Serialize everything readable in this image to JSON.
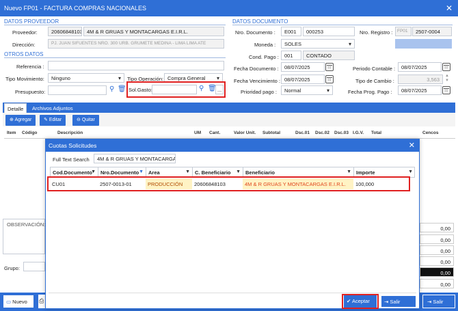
{
  "window": {
    "title": "Nuevo FP01 - FACTURA COMPRAS NACIONALES",
    "close": "✕"
  },
  "proveedor": {
    "section": "DATOS PROVEEDOR",
    "proveedor_label": "Proveedor:",
    "ruc": "20606848103",
    "name": "4M & R GRUAS Y MONTACARGAS E.I.R.L.",
    "direccion_label": "Dirección:",
    "direccion": "PJ. JUAN SIFUENTES NRO. 300 URB. GRUMETE MEDINA - LIMA LIMA ATE"
  },
  "documento": {
    "section": "DATOS DOCUMENTO",
    "nro_label": "Nro. Documento :",
    "serie": "E001",
    "numero": "000253",
    "registro_label": "Nro. Registro :",
    "reg_prefix": "FP01",
    "reg_number": "2507-0004",
    "moneda_label": "Moneda :",
    "moneda": "SOLES",
    "cond_label": "Cond. Pago :",
    "cond_code": "001",
    "cond_name": "CONTADO",
    "fecha_doc_label": "Fecha Documento :",
    "fecha_doc": "08/07/2025",
    "periodo_label": "Periodo Contable :",
    "periodo": "08/07/2025",
    "fecha_venc_label": "Fecha Vencimiento :",
    "fecha_venc": "08/07/2025",
    "tipo_cambio_label": "Tipo de Cambio :",
    "tipo_cambio": "3,563",
    "prioridad_label": "Prioridad pago :",
    "prioridad": "Normal",
    "fecha_prog_label": "Fecha Prog. Pago :",
    "fecha_prog": "08/07/2025"
  },
  "otros": {
    "section": "OTROS DATOS",
    "referencia_label": "Referencia :",
    "tipo_mov_label": "Tipo Movimiento:",
    "tipo_mov": "Ninguno",
    "tipo_op_label": "Tipo Operación:",
    "tipo_op": "Compra General",
    "presupuesto_label": "Presupuesto:",
    "sol_gasto_label": "Sol.Gasto:",
    "more": "..."
  },
  "tabs": [
    "Detalle",
    "Archivos Adjuntos"
  ],
  "toolbar": {
    "agregar": "Agregar",
    "editar": "Editar",
    "quitar": "Quitar"
  },
  "detail_columns": [
    "Item",
    "Código",
    "Descripción",
    "UM",
    "Cant.",
    "Valor Unit.",
    "Subtotal",
    "Dsc.01",
    "Dsc.02",
    "Dsc.03",
    "I.G.V.",
    "Total",
    "Cencos"
  ],
  "observacion_label": "OBSERVACIÓN:",
  "grupo_label": "Grupo:",
  "totals": [
    "0,00",
    "0,00",
    "0,00",
    "0,00",
    "0,00",
    "0,00",
    "0,00"
  ],
  "bottom": {
    "nuevo": "Nuevo",
    "salir": "Salir"
  },
  "modal": {
    "title": "Cuotas Solicitudes",
    "close": "✕",
    "search_label": "Full Text Search",
    "search_value": "4M & R GRUAS Y MONTACARGAS",
    "columns": [
      "Cod.Documento",
      "Nro.Documento",
      "Area",
      "C. Beneficiario",
      "Beneficiario",
      "Importe"
    ],
    "rows": [
      {
        "cod": "CU01",
        "nro": "2507-0013-01",
        "area": "PRODUCCIÓN",
        "cben": "20606848103",
        "ben": "4M & R GRUAS Y MONTACARGAS E.I.R.L.",
        "importe": "100,000"
      }
    ],
    "aceptar": "Aceptar",
    "salir": "Salir"
  },
  "colors": {
    "primary": "#2f6fd6",
    "highlight": "#e02020",
    "area_bg": "#fff3c4",
    "beneficiario_text": "#e0451c"
  }
}
